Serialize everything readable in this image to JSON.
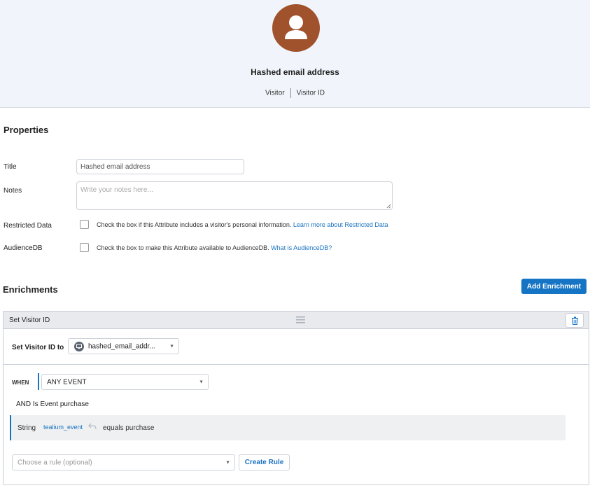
{
  "attribute": {
    "title": "Hashed email address",
    "scope": "Visitor",
    "type": "Visitor ID",
    "avatar_icon": "person-icon",
    "avatar_color": "#a0522d"
  },
  "properties": {
    "heading": "Properties",
    "title_label": "Title",
    "title_value": "Hashed email address",
    "notes_label": "Notes",
    "notes_placeholder": "Write your notes here...",
    "restricted_label": "Restricted Data",
    "restricted_text": "Check the box if this Attribute includes a visitor's personal information.",
    "restricted_link": "Learn more about Restricted Data",
    "audiencedb_label": "AudienceDB",
    "audiencedb_text": "Check the box to make this Attribute available to AudienceDB.",
    "audiencedb_link": "What is AudienceDB?"
  },
  "enrichments": {
    "heading": "Enrichments",
    "add_button": "Add Enrichment",
    "card": {
      "title": "Set Visitor ID",
      "set_label": "Set Visitor ID to",
      "set_value": "hashed_email_addr...",
      "when_label": "WHEN",
      "when_value": "ANY EVENT",
      "and_prefix": "AND",
      "and_rule": "Is Event purchase",
      "condition_type": "String",
      "condition_attribute": "tealium_event",
      "condition_operator": "equals purchase",
      "rule_placeholder": "Choose a rule (optional)",
      "create_rule_button": "Create Rule"
    }
  },
  "colors": {
    "accent": "#1574c4",
    "header_bg": "#f1f5fb"
  }
}
